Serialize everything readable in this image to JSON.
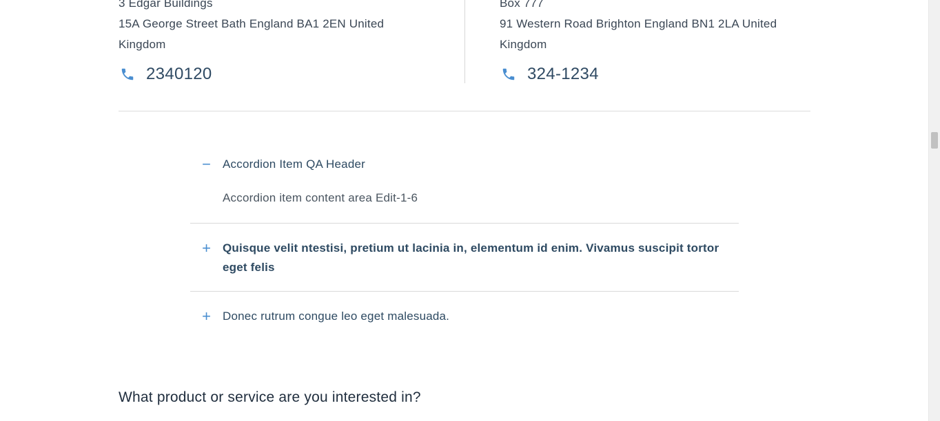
{
  "locations": [
    {
      "address_lines": [
        "3 Edgar Buildings",
        "15A George Street Bath England BA1 2EN United",
        "Kingdom"
      ],
      "phone": "2340120"
    },
    {
      "address_lines": [
        "Box 777",
        "91 Western Road Brighton England BN1 2LA United",
        "Kingdom"
      ],
      "phone": "324-1234"
    }
  ],
  "accordion": {
    "items": [
      {
        "toggle": "−",
        "title": "Accordion Item QA Header",
        "expanded": true,
        "content": "Accordion item content area Edit-1-6"
      },
      {
        "toggle": "+",
        "title_line1": "Quisque velit ntestisi, pretium ut lacinia in, elementum id enim. Vivamus suscipit tortor",
        "title_line2": "eget felis",
        "expanded": false
      },
      {
        "toggle": "+",
        "title": "Donec rutrum congue leo eget malesuada.",
        "expanded": false
      }
    ]
  },
  "section_heading": "What product or service are you interested in?",
  "icons": {
    "phone": "phone-icon",
    "minus": "minus-icon",
    "plus": "plus-icon"
  },
  "colors": {
    "accent": "#4a8ed0",
    "heading_text": "#2e4a62",
    "body_text": "#3a4654"
  }
}
